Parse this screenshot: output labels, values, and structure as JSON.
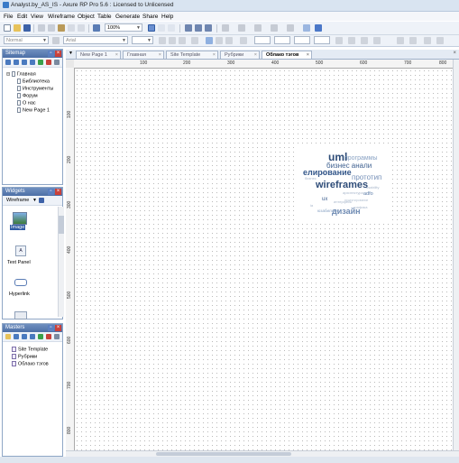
{
  "window": {
    "title": "Analyst.by_AS_IS - Axure RP Pro 5.6 : Licensed to Unlicensed"
  },
  "menu": [
    "File",
    "Edit",
    "View",
    "Wireframe",
    "Object",
    "Table",
    "Generate",
    "Share",
    "Help"
  ],
  "toolbar": {
    "zoom": "100%",
    "style": "Normal",
    "font": "Arial"
  },
  "sitemap": {
    "title": "Sitemap",
    "items": [
      "Главная",
      "Библиотека",
      "Инструменты",
      "Форум",
      "О нас",
      "New Page 1"
    ]
  },
  "widgets": {
    "title": "Widgets",
    "library": "Wireframe",
    "items": [
      "Image",
      "Text Panel",
      "Hyperlink"
    ]
  },
  "masters": {
    "title": "Masters",
    "items": [
      "Site Template",
      "Рубрики",
      "Облако тэгов"
    ]
  },
  "tabs": [
    "New Page 1",
    "Главная",
    "Site Template",
    "Рубрики",
    "Облако тэгов"
  ],
  "ruler_top": [
    "100",
    "200",
    "300",
    "400",
    "500",
    "600",
    "700",
    "800"
  ],
  "ruler_left": [
    "100",
    "200",
    "300",
    "400",
    "500",
    "600",
    "700",
    "800"
  ],
  "tagcloud": {
    "tags": [
      "uml",
      "программы",
      "бизнес анали",
      "елирование",
      "прототип",
      "wireframes",
      "adfo",
      "ux",
      "дизайн",
      "юзабилити"
    ],
    "small_tags": [
      "бизнес",
      "архитектура",
      "интерфейс",
      "проектирование",
      "графика",
      "веб",
      "usability",
      "ia"
    ]
  },
  "colors": {
    "accent": "#3b5f91",
    "tag_dark": "#2e4c78",
    "tag_light": "#8aa3c4"
  }
}
